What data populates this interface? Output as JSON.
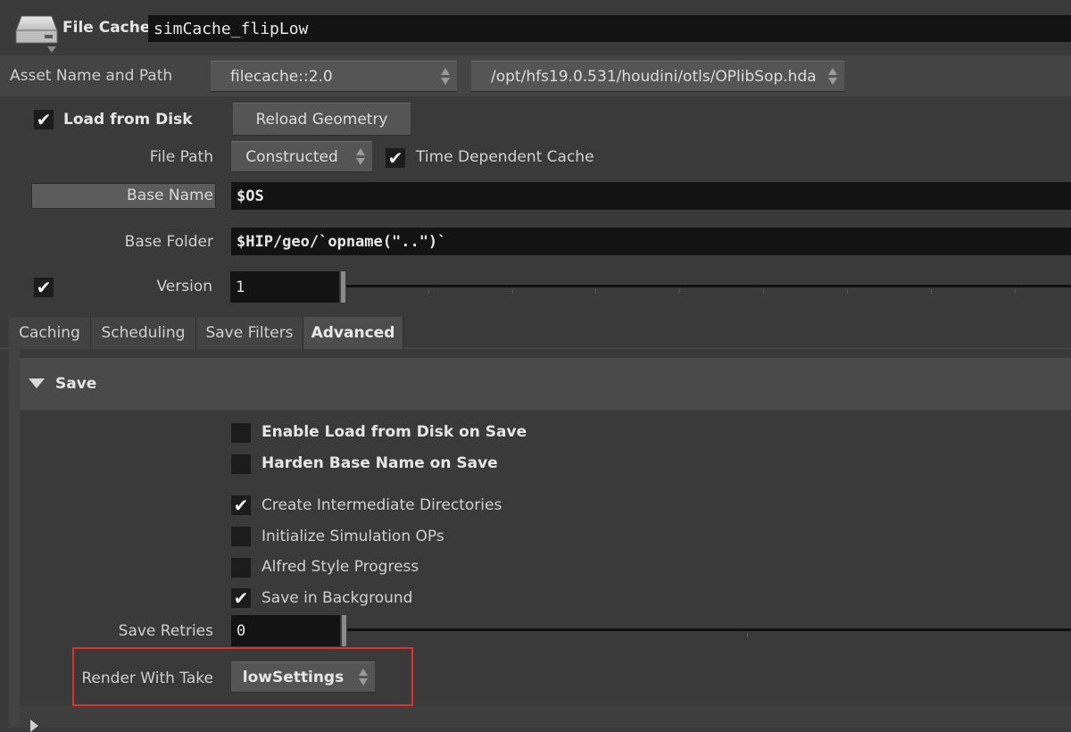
{
  "header": {
    "node_type": "File Cache",
    "node_name": "simCache_flipLow"
  },
  "asset": {
    "label": "Asset Name and Path",
    "name": "filecache::2.0",
    "path": "/opt/hfs19.0.531/houdini/otls/OPlibSop.hda"
  },
  "load": {
    "checkbox_label": "Load from Disk",
    "checked": true,
    "reload_button": "Reload Geometry"
  },
  "file_path": {
    "label": "File Path",
    "value": "Constructed",
    "time_dependent_label": "Time Dependent Cache",
    "time_dependent_checked": true
  },
  "base_name": {
    "label": "Base Name",
    "value": "$OS"
  },
  "base_folder": {
    "label": "Base Folder",
    "value": "$HIP/geo/`opname(\"..\")`"
  },
  "version": {
    "label": "Version",
    "value": "1",
    "checked": true
  },
  "tabs": [
    {
      "label": "Caching",
      "active": false
    },
    {
      "label": "Scheduling",
      "active": false
    },
    {
      "label": "Save Filters",
      "active": false
    },
    {
      "label": "Advanced",
      "active": true
    }
  ],
  "save_section": {
    "title": "Save",
    "options": [
      {
        "label": "Enable Load from Disk on Save",
        "checked": false,
        "bold": true
      },
      {
        "label": "Harden Base Name on Save",
        "checked": false,
        "bold": true
      },
      {
        "label": "Create Intermediate Directories",
        "checked": true,
        "bold": false
      },
      {
        "label": "Initialize Simulation OPs",
        "checked": false,
        "bold": false
      },
      {
        "label": "Alfred Style Progress",
        "checked": false,
        "bold": false
      },
      {
        "label": "Save in Background",
        "checked": true,
        "bold": false
      }
    ],
    "save_retries_label": "Save Retries",
    "save_retries_value": "0",
    "render_take_label": "Render With Take",
    "render_take_value": "lowSettings"
  },
  "colors": {
    "background": "#3a3a3a",
    "field": "#131313",
    "highlight_box": "#e0302a"
  },
  "icons": {
    "node_icon": "hard-drive-icon",
    "check": "checkmark-icon",
    "section_toggle": "triangle-down-icon"
  }
}
